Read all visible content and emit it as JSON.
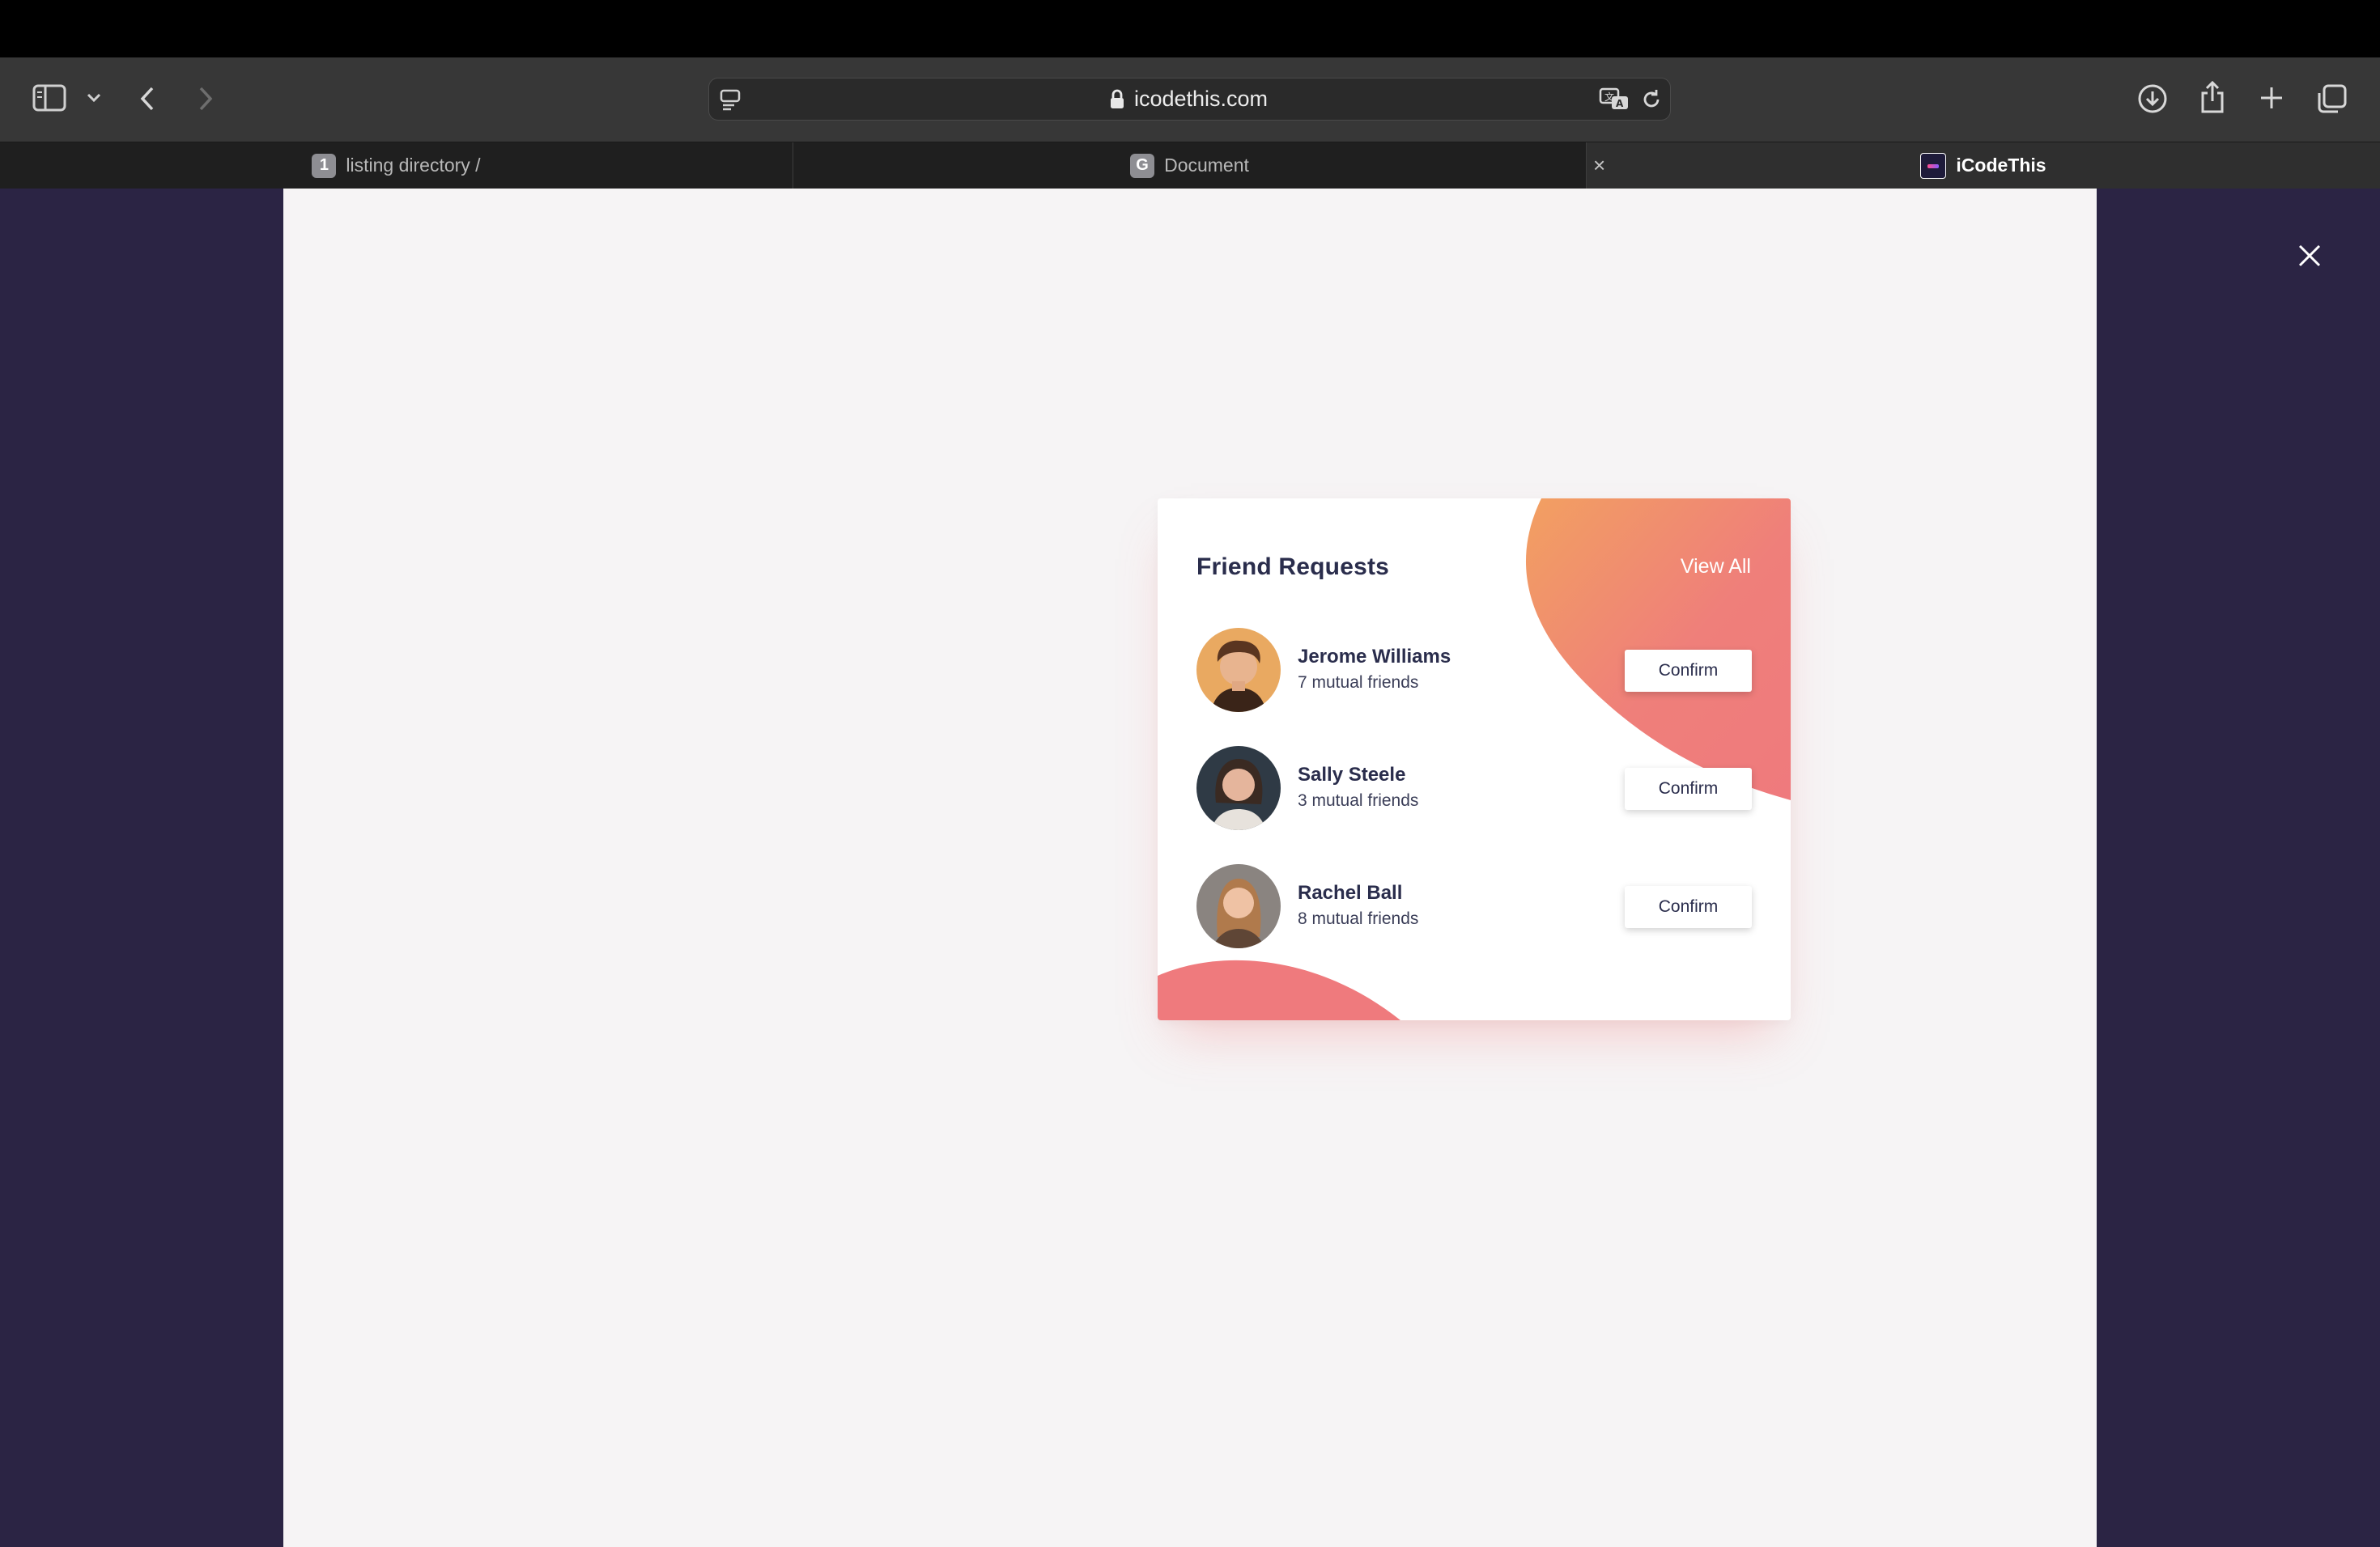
{
  "browser": {
    "url": "icodethis.com",
    "tabs": [
      {
        "badge": "1",
        "title": "listing directory /"
      },
      {
        "badge": "G",
        "title": "Document"
      },
      {
        "title": "iCodeThis"
      }
    ],
    "tab_close_glyph": "×"
  },
  "card": {
    "title": "Friend Requests",
    "view_all": "View All",
    "requests": [
      {
        "name": "Jerome Williams",
        "mutual": "7 mutual friends",
        "action": "Confirm"
      },
      {
        "name": "Sally Steele",
        "mutual": "3 mutual friends",
        "action": "Confirm"
      },
      {
        "name": "Rachel Ball",
        "mutual": "8 mutual friends",
        "action": "Confirm"
      }
    ]
  },
  "colors": {
    "page_background": "#2b2444",
    "canvas": "#f6f4f5",
    "accent_orange": "#f2a061",
    "accent_pink": "#ef7a7d",
    "text_dark": "#2a2d4c"
  }
}
